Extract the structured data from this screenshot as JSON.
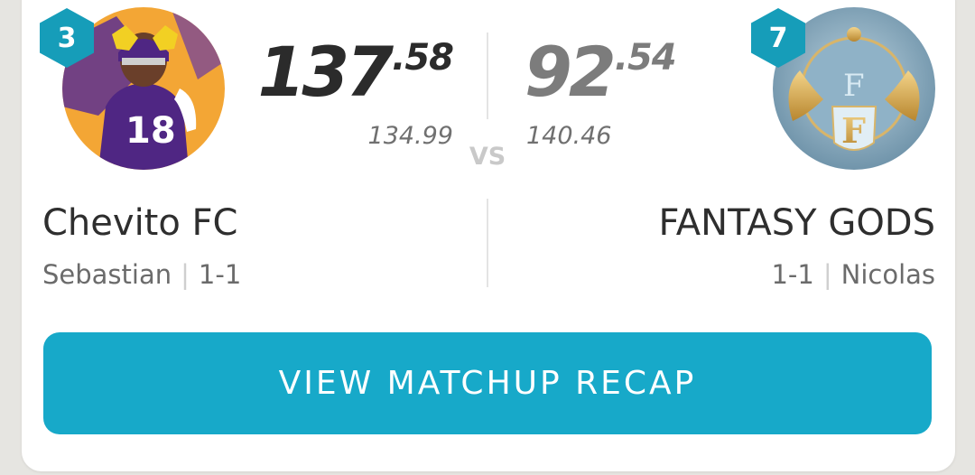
{
  "matchup": {
    "home": {
      "rank": "3",
      "score_int": "137",
      "score_dec": ".58",
      "projected": "134.99",
      "team_name": "Chevito FC",
      "owner": "Sebastian",
      "record": "1-1",
      "score_color": "#2b2b2b"
    },
    "away": {
      "rank": "7",
      "score_int": "92",
      "score_dec": ".54",
      "projected": "140.46",
      "team_name": "FANTASY GODS",
      "owner": "Nicolas",
      "record": "1-1",
      "score_color": "#7c7c7c"
    },
    "vs_label": "VS",
    "separator": "|"
  },
  "recap_button": {
    "label": "VIEW MATCHUP RECAP",
    "color": "#17a9c9"
  },
  "colors": {
    "rank_badge": "#169db9",
    "card_bg": "#ffffff",
    "page_bg": "#e6e5e1"
  },
  "icons": {
    "home_avatar": "football-player-avatar",
    "away_avatar": "winged-crest-logo"
  }
}
